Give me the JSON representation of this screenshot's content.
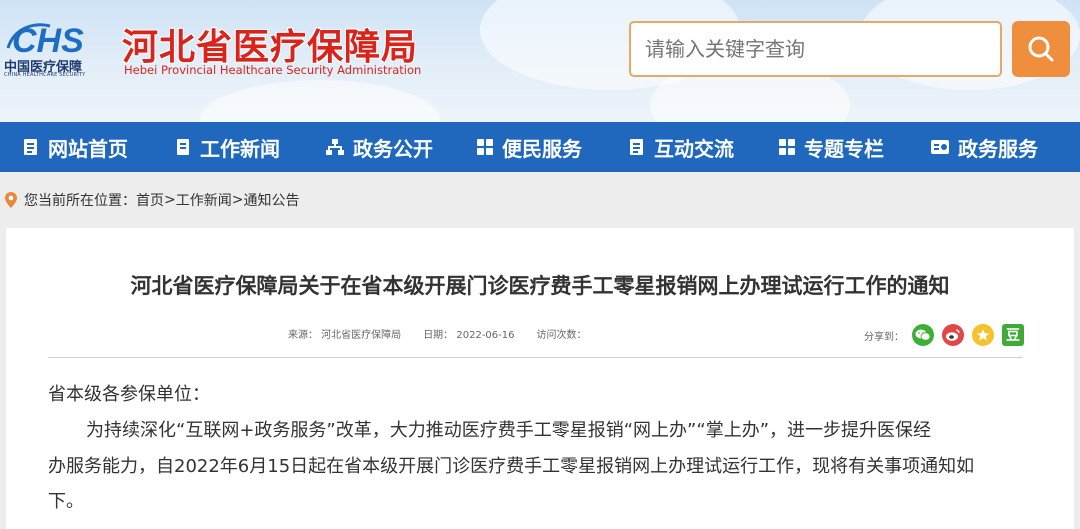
{
  "header": {
    "logo_text": "CHS",
    "logo_cn": "中国医疗保障",
    "logo_en": "CHINA HEALTHCARE SECURITY",
    "site_title": "河北省医疗保障局",
    "site_subtitle": "Hebei Provincial Healthcare Security Administration"
  },
  "search": {
    "placeholder": "请输入关键字查询",
    "icon": "search-icon"
  },
  "nav": {
    "items": [
      {
        "label": "网站首页",
        "icon": "doc-icon"
      },
      {
        "label": "工作新闻",
        "icon": "bookmark-icon"
      },
      {
        "label": "政务公开",
        "icon": "network-icon"
      },
      {
        "label": "便民服务",
        "icon": "grid-icon"
      },
      {
        "label": "互动交流",
        "icon": "doc-icon"
      },
      {
        "label": "专题专栏",
        "icon": "grid-icon"
      },
      {
        "label": "政务服务",
        "icon": "card-icon"
      }
    ]
  },
  "breadcrumb": {
    "prefix": "您当前所在位置：",
    "home": "首页",
    "sep1": ">",
    "news": "工作新闻",
    "sep2": ">",
    "current": "通知公告"
  },
  "article": {
    "title": "河北省医疗保障局关于在省本级开展门诊医疗费手工零星报销网上办理试运行工作的通知",
    "source": "来源：  河北省医疗保障局",
    "date": "日期：  2022-06-16",
    "visits": "访问次数：",
    "share_label": "分享到：",
    "share_icons": [
      "wechat-icon",
      "weibo-icon",
      "qzone-icon",
      "douban-icon"
    ],
    "douban_char": "豆",
    "greeting": "省本级各参保单位：",
    "paragraph_line1": "为持续深化“互联网+政务服务”改革，大力推动医疗费手工零星报销“网上办”“掌上办”，进一步提升医保经",
    "paragraph_line2": "办服务能力，自2022年6月15日起在省本级开展门诊医疗费手工零星报销网上办理试运行工作，现将有关事项通知如",
    "paragraph_line3": "下。"
  },
  "colors": {
    "nav_bg": "#1f68bd",
    "title_red": "#d9241c",
    "search_orange": "#ef8e3c",
    "logo_blue": "#1e6dc4"
  }
}
